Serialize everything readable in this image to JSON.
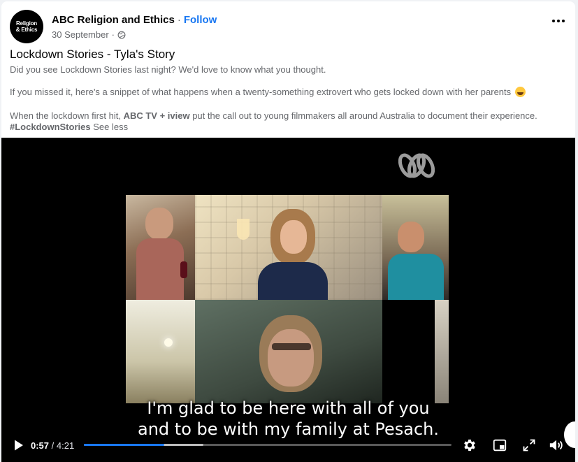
{
  "post": {
    "page_name": "ABC Religion and Ethics",
    "separator": "·",
    "follow_label": "Follow",
    "date": "30 September",
    "date_separator": "·",
    "avatar": {
      "line1": "Religion",
      "line2": "& Ethics"
    },
    "title": "Lockdown Stories - Tyla's Story",
    "paragraph1": "Did you see Lockdown Stories last night? We'd love to know what you thought.",
    "paragraph2": "If you missed it, here's a snippet of what happens when a twenty-something extrovert who gets locked down with her parents",
    "paragraph3_start": "When the lockdown first hit, ",
    "paragraph3_bold": "ABC TV + iview",
    "paragraph3_end": " put the call out to young filmmakers all around Australia to document their experience.",
    "hashtag": "#LockdownStories",
    "see_less": "See less"
  },
  "video": {
    "subtitle_line1": "I'm glad to be here with all of you",
    "subtitle_line2": "and to be with my family at Pesach.",
    "current_time": "0:57",
    "time_separator": " / ",
    "duration": "4:21",
    "played_fraction": 0.218,
    "buffered_fraction": 0.325
  },
  "icons": {
    "more": "more-horizontal-icon",
    "globe": "globe-icon",
    "play": "play-icon",
    "settings": "gear-icon",
    "pip": "picture-in-picture-icon",
    "fullscreen": "fullscreen-icon",
    "volume": "volume-icon"
  },
  "colors": {
    "accent": "#1877f2",
    "secondary_text": "#65676b"
  }
}
